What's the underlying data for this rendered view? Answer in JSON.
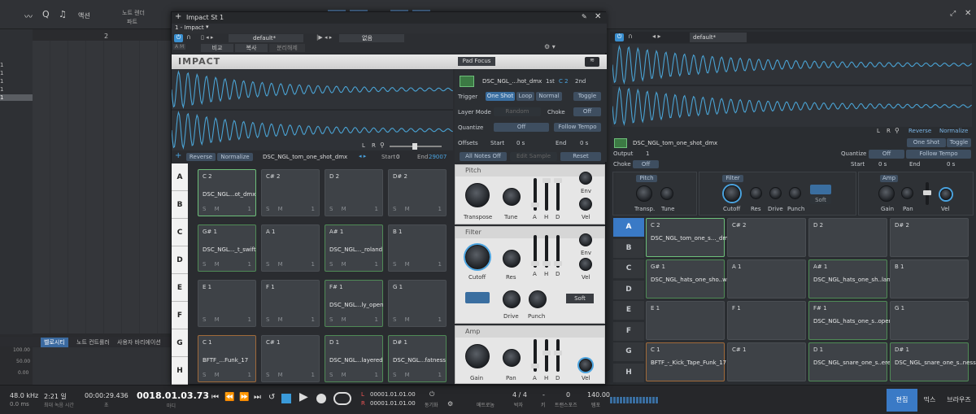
{
  "daw": {
    "top_menu": {
      "action": "액션",
      "note_speed": "노트 렌더",
      "part": "파트"
    },
    "ruler": {
      "mark2": "2"
    },
    "track_numbers": [
      "1",
      "1",
      "1",
      "1",
      "1",
      "1"
    ],
    "bottom_tabs": [
      "벨로시티",
      "노트 컨트롤러",
      "사용자 바리에이션"
    ],
    "vel_scale": [
      "100.00",
      "50.00",
      "0.00"
    ],
    "transport": {
      "sample_rate": "48.0 kHz",
      "latency": "0.0 ms",
      "duration": "2:21 일",
      "duration_sub": "최대 녹음 시간",
      "time_sec": "00:00:29.436",
      "time_sec_sub": "초",
      "position": "0018.01.03.73",
      "position_sub": "마디",
      "loop_L": "00001.01.01.00",
      "loop_R": "00001.01.01.00",
      "sync": "동기화",
      "metronome": "메트로놈",
      "meter": "4 / 4",
      "meter_sub": "박자",
      "key": "-",
      "key_sub": "키",
      "transpose": "0",
      "transpose_sub": "트랜스포즈",
      "tempo": "140.00",
      "tempo_sub": "템포",
      "L": "L",
      "R": "R",
      "edit": "편집",
      "mix": "믹스",
      "browse": "브라우즈"
    }
  },
  "plugin": {
    "window_title": "Impact St 1",
    "instance": "1 - Impact",
    "preset": "default*",
    "preset_empty": "없음",
    "toolbar": {
      "compare": "비교",
      "copy": "복사",
      "unlink": "분리해제"
    },
    "logo": "IMPACT",
    "pad_focus": "Pad Focus",
    "wave_ctrl": {
      "L": "L",
      "R": "R"
    },
    "sample_bar": {
      "reverse": "Reverse",
      "normalize": "Normalize",
      "filename": "DSC_NGL_tom_one_shot_dmx",
      "start_label": "Start",
      "start_val": "0",
      "end_label": "End",
      "end_val": "29007"
    },
    "inspector": {
      "sample": "DSC_NGL_...hot_dmx",
      "oct1": "1st",
      "note": "C 2",
      "oct2": "2nd",
      "trigger": "Trigger",
      "one_shot": "One Shot",
      "loop": "Loop",
      "normal": "Normal",
      "toggle": "Toggle",
      "layer_mode": "Layer Mode",
      "layer_val": "Random",
      "choke": "Choke",
      "choke_val": "Off",
      "quantize": "Quantize",
      "quantize_val": "Off",
      "follow_tempo": "Follow Tempo",
      "offsets": "Offsets",
      "start": "Start",
      "start_val": "0 s",
      "end": "End",
      "end_val": "0 s",
      "all_notes_off": "All Notes Off",
      "edit_sample": "Edit Sample",
      "reset": "Reset"
    },
    "pitch": {
      "title": "Pitch",
      "transpose": "Transpose",
      "tune": "Tune",
      "a": "A",
      "h": "H",
      "d": "D",
      "env": "Env",
      "vel": "Vel"
    },
    "filter": {
      "title": "Filter",
      "cutoff": "Cutoff",
      "res": "Res",
      "drive": "Drive",
      "punch": "Punch",
      "env": "Env",
      "vel": "Vel",
      "soft": "Soft",
      "a": "A",
      "h": "H",
      "d": "D"
    },
    "amp": {
      "title": "Amp",
      "gain": "Gain",
      "pan": "Pan",
      "vel": "Vel",
      "a": "A",
      "h": "H",
      "d": "D"
    },
    "rows": [
      "A",
      "B",
      "C",
      "D",
      "E",
      "F",
      "G",
      "H"
    ],
    "pads": [
      {
        "note": "C 2",
        "name": "DSC_NGL...ot_dmx"
      },
      {
        "note": "C# 2",
        "name": ""
      },
      {
        "note": "D 2",
        "name": ""
      },
      {
        "note": "D# 2",
        "name": ""
      },
      {
        "note": "G# 1",
        "name": "DSC_NGL..._t_swift"
      },
      {
        "note": "A 1",
        "name": ""
      },
      {
        "note": "A# 1",
        "name": "DSC_NGL..._roland"
      },
      {
        "note": "B 1",
        "name": ""
      },
      {
        "note": "E 1",
        "name": ""
      },
      {
        "note": "F 1",
        "name": ""
      },
      {
        "note": "F# 1",
        "name": "DSC_NGL...ly_open"
      },
      {
        "note": "G 1",
        "name": ""
      },
      {
        "note": "C 1",
        "name": "BFTF_...Funk_17"
      },
      {
        "note": "C# 1",
        "name": ""
      },
      {
        "note": "D 1",
        "name": "DSC_NGL...layered"
      },
      {
        "note": "D# 1",
        "name": "DSC_NGL...fatness"
      }
    ],
    "pad_sm": "S  M",
    "pad_one": "1"
  },
  "inline": {
    "preset": "default*",
    "wave_ctrl": {
      "L": "L",
      "R": "R",
      "reverse": "Reverse",
      "normalize": "Normalize"
    },
    "sample": "DSC_NGL_tom_one_shot_dmx",
    "one_shot": "One Shot",
    "toggle": "Toggle",
    "output": "Output",
    "output_val": "1",
    "quantize": "Quantize",
    "quantize_val": "Off",
    "follow_tempo": "Follow Tempo",
    "choke": "Choke",
    "choke_val": "Off",
    "start": "Start",
    "start_val": "0 s",
    "end": "End",
    "end_val": "0 s",
    "pitch": {
      "title": "Pitch",
      "transp": "Transp.",
      "tune": "Tune"
    },
    "filter": {
      "title": "Filter",
      "cutoff": "Cutoff",
      "res": "Res",
      "drive": "Drive",
      "punch": "Punch",
      "soft": "Soft"
    },
    "amp": {
      "title": "Amp",
      "gain": "Gain",
      "pan": "Pan",
      "vel": "Vel"
    },
    "rows": [
      "A",
      "B",
      "C",
      "D",
      "E",
      "F",
      "G",
      "H"
    ],
    "pads": [
      {
        "note": "C 2",
        "name": "DSC_NGL_tom_one_s..._dmx"
      },
      {
        "note": "C# 2",
        "name": ""
      },
      {
        "note": "D 2",
        "name": ""
      },
      {
        "note": "D# 2",
        "name": ""
      },
      {
        "note": "G# 1",
        "name": "DSC_NGL_hats_one_sho..wift"
      },
      {
        "note": "A 1",
        "name": ""
      },
      {
        "note": "A# 1",
        "name": "DSC_NGL_hats_one_sh..land"
      },
      {
        "note": "B 1",
        "name": ""
      },
      {
        "note": "E 1",
        "name": ""
      },
      {
        "note": "F 1",
        "name": ""
      },
      {
        "note": "F# 1",
        "name": "DSC_NGL_hats_one_s..open"
      },
      {
        "note": "G 1",
        "name": ""
      },
      {
        "note": "C 1",
        "name": "BFTF_-_Kick_Tape_Funk_17"
      },
      {
        "note": "C# 1",
        "name": ""
      },
      {
        "note": "D 1",
        "name": "DSC_NGL_snare_one_s..ered"
      },
      {
        "note": "D# 1",
        "name": "DSC_NGL_snare_one_s..ness"
      }
    ]
  },
  "colors": {
    "accent": "#3a8fd0",
    "wave": "#4aa3d4",
    "pad_green": "#4f8a56",
    "pad_orange": "#a06a3a"
  }
}
